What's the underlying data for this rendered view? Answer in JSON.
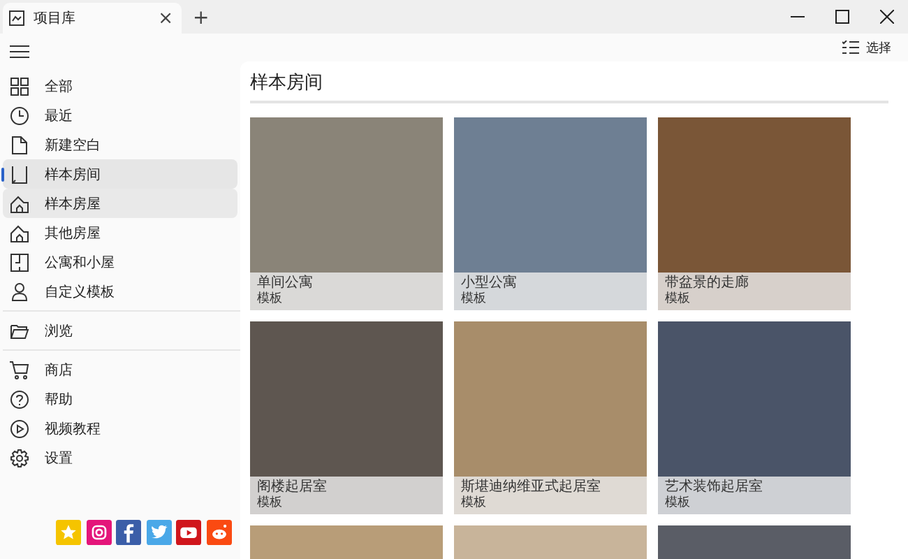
{
  "tab": {
    "title": "项目库",
    "close": "×"
  },
  "new_tab": "+",
  "toolbar": {
    "select": "选择"
  },
  "sidebar": {
    "groups": [
      [
        {
          "label": "全部",
          "selected": false,
          "hovered": false
        },
        {
          "label": "最近",
          "selected": false,
          "hovered": false
        },
        {
          "label": "新建空白",
          "selected": false,
          "hovered": false
        },
        {
          "label": "样本房间",
          "selected": true,
          "hovered": false
        },
        {
          "label": "样本房屋",
          "selected": false,
          "hovered": true
        },
        {
          "label": "其他房屋",
          "selected": false,
          "hovered": false
        },
        {
          "label": "公寓和小屋",
          "selected": false,
          "hovered": false
        },
        {
          "label": "自定义模板",
          "selected": false,
          "hovered": false
        }
      ],
      [
        {
          "label": "浏览",
          "selected": false,
          "hovered": false
        }
      ],
      [
        {
          "label": "商店",
          "selected": false,
          "hovered": false
        },
        {
          "label": "帮助",
          "selected": false,
          "hovered": false
        },
        {
          "label": "视频教程",
          "selected": false,
          "hovered": false
        },
        {
          "label": "设置",
          "selected": false,
          "hovered": false
        }
      ]
    ],
    "social": [
      {
        "kind": "star",
        "color": "#f5c400"
      },
      {
        "kind": "instagram",
        "color": "#e4157a"
      },
      {
        "kind": "facebook",
        "color": "#3b5ea8"
      },
      {
        "kind": "twitter",
        "color": "#4aa8e8"
      },
      {
        "kind": "youtube",
        "color": "#d0161c"
      },
      {
        "kind": "reddit",
        "color": "#fa4a12"
      }
    ]
  },
  "section_title": "样本房间",
  "cards": [
    {
      "title": "单间公寓",
      "subtitle": "模板",
      "color": "#8a8478"
    },
    {
      "title": "小型公寓",
      "subtitle": "模板",
      "color": "#6e7f93"
    },
    {
      "title": "带盆景的走廊",
      "subtitle": "模板",
      "color": "#7a5637"
    },
    {
      "title": "阁楼起居室",
      "subtitle": "模板",
      "color": "#5e5650"
    },
    {
      "title": "斯堪迪纳维亚式起居室",
      "subtitle": "模板",
      "color": "#a88d6a"
    },
    {
      "title": "艺术装饰起居室",
      "subtitle": "模板",
      "color": "#4a5468"
    },
    {
      "color": "#b89d78"
    },
    {
      "color": "#c8b49a"
    },
    {
      "color": "#5a5d66"
    }
  ]
}
